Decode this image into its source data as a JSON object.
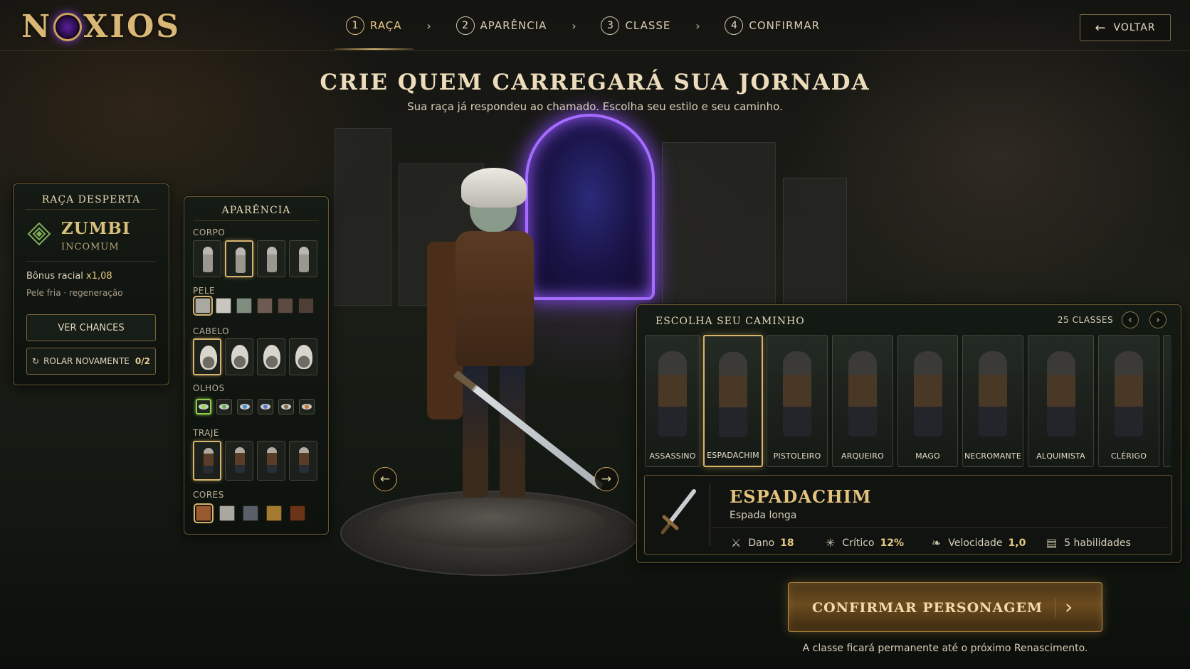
{
  "logo": {
    "text_left": "N",
    "text_right": "XIOS"
  },
  "steps": [
    {
      "num": "1",
      "label": "RAÇA",
      "active": true
    },
    {
      "num": "2",
      "label": "APARÊNCIA",
      "active": false
    },
    {
      "num": "3",
      "label": "CLASSE",
      "active": false
    },
    {
      "num": "4",
      "label": "CONFIRMAR",
      "active": false
    }
  ],
  "back_button": {
    "label": "VOLTAR",
    "icon": "arrow-left-icon"
  },
  "headline": "CRIE QUEM CARREGARÁ SUA JORNADA",
  "subheadline": "Sua raça já respondeu ao chamado. Escolha seu estilo e seu caminho.",
  "race_panel": {
    "title": "RAÇA DESPERTA",
    "race_name": "ZUMBI",
    "rarity": "INCOMUM",
    "bonus_label": "Bônus racial",
    "bonus_value": "x1,08",
    "description": "Pele fria · regeneração",
    "see_chances_label": "VER CHANCES",
    "reroll_label": "ROLAR NOVAMENTE",
    "reroll_count": "0/2"
  },
  "appearance_panel": {
    "title": "APARÊNCIA",
    "sections": {
      "body": {
        "label": "CORPO",
        "options": 4,
        "selected": 1
      },
      "skin": {
        "label": "PELE",
        "colors": [
          "#a9a9a2",
          "#c8c6bf",
          "#7f8d7f",
          "#6d5a50",
          "#5a4a40",
          "#4d3e36"
        ],
        "selected": 0
      },
      "hair": {
        "label": "CABELO",
        "options": 4,
        "selected": 0
      },
      "eyes": {
        "label": "OLHOS",
        "colors": [
          "#8fe04a",
          "#6ab04a",
          "#4a8fd0",
          "#5a7ad0",
          "#8a6a4a",
          "#c87a3a"
        ],
        "selected": 0
      },
      "outfit": {
        "label": "TRAJE",
        "options": 4,
        "selected": 0
      },
      "colors": {
        "label": "CORES",
        "colors": [
          "#9a5a30",
          "#a8a8a0",
          "#5a5e66",
          "#a37a30",
          "#6a3418"
        ],
        "selected": 0
      }
    }
  },
  "class_panel": {
    "title": "ESCOLHA SEU CAMINHO",
    "count": "25 CLASSES",
    "classes": [
      {
        "name": "ASSASSINO",
        "selected": false
      },
      {
        "name": "ESPADACHIM",
        "selected": true
      },
      {
        "name": "PISTOLEIRO",
        "selected": false
      },
      {
        "name": "ARQUEIRO",
        "selected": false
      },
      {
        "name": "MAGO",
        "selected": false
      },
      {
        "name": "NECROMANTE",
        "selected": false
      },
      {
        "name": "ALQUIMISTA",
        "selected": false
      },
      {
        "name": "CLÉRIGO",
        "selected": false
      }
    ],
    "detail": {
      "name": "ESPADACHIM",
      "weapon": "Espada longa",
      "stats": [
        {
          "icon": "sword-icon",
          "label": "Dano",
          "value": "18"
        },
        {
          "icon": "burst-icon",
          "label": "Crítico",
          "value": "12%"
        },
        {
          "icon": "wing-icon",
          "label": "Velocidade",
          "value": "1,0"
        },
        {
          "icon": "book-icon",
          "label": "5 habilidades",
          "value": ""
        }
      ]
    }
  },
  "confirm_button": {
    "label": "CONFIRMAR PERSONAGEM"
  },
  "footer_note": "A classe ficará permanente até o próximo Renascimento.",
  "colors": {
    "gold": "#d9b774",
    "accent_purple": "#8a4dff",
    "panel_bg": "#141a14"
  }
}
